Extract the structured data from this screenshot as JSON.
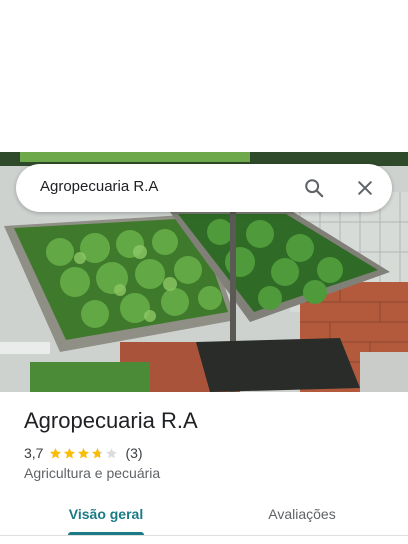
{
  "search": {
    "query": "Agropecuaria R.A",
    "search_icon": "search-icon",
    "close_icon": "close-icon"
  },
  "place": {
    "photo_subject": "seedling trays photo",
    "name": "Agropecuaria R.A",
    "rating": "3,7",
    "rating_value": 3.7,
    "stars_max": 5,
    "review_count": "(3)",
    "category": "Agricultura e pecuária"
  },
  "tabs": [
    {
      "label": "Visão geral",
      "selected": true
    },
    {
      "label": "Avaliações",
      "selected": false
    }
  ],
  "colors": {
    "accent": "#1a7b86",
    "star_filled": "#fbbc04",
    "star_empty": "#dadce0"
  }
}
